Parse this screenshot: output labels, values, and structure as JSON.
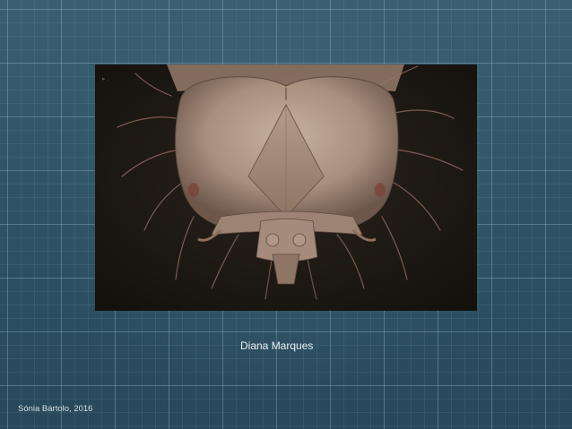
{
  "slide": {
    "image_alt": "scanning electron micrograph of an insect larva head",
    "caption": "Diana Marques",
    "credit": "Sónia Bártolo, 2016"
  },
  "colors": {
    "background": "#2f5366",
    "grid_line": "#8cafc3",
    "photo_background": "#1c1813",
    "specimen": "#b8a08f",
    "text": "#e8eef2"
  }
}
